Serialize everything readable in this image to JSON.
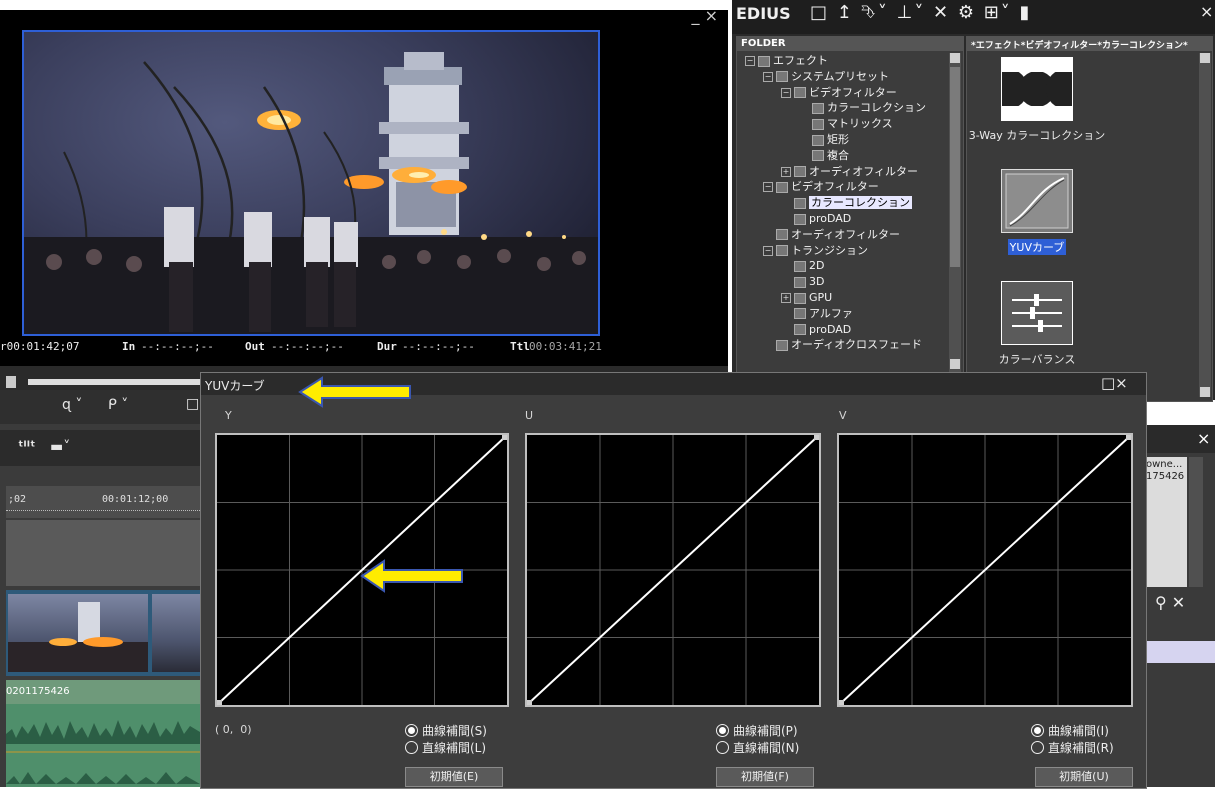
{
  "player": {
    "close_controls": "_ ×",
    "timecodes": {
      "cur": "00:01:42;07",
      "in_label": "In",
      "in_value": "--:--:--;--",
      "out_label": "Out",
      "out_value": "--:--:--;--",
      "dur_label": "Dur",
      "dur_value": "--:--:--;--",
      "ttl_label": "Ttl",
      "ttl_value": "00:03:41;21"
    }
  },
  "timeline": {
    "ruler": {
      "left": ";02",
      "right": "00:01:12;00"
    },
    "clip_name": "0201175426"
  },
  "bin": {
    "app_name": "EDIUS",
    "toolbar_glyphs": "□ ↥ ⮷˅ ⊥˅ ✕ ⚙ ⊞˅ ▮",
    "close": "×",
    "folder_header": "FOLDER",
    "tree": [
      {
        "label": "エフェクト",
        "indent": 0,
        "expander": "−"
      },
      {
        "label": "システムプリセット",
        "indent": 1,
        "expander": "−"
      },
      {
        "label": "ビデオフィルター",
        "indent": 2,
        "expander": "−"
      },
      {
        "label": "カラーコレクション",
        "indent": 3,
        "expander": ""
      },
      {
        "label": "マトリックス",
        "indent": 3,
        "expander": ""
      },
      {
        "label": "矩形",
        "indent": 3,
        "expander": ""
      },
      {
        "label": "複合",
        "indent": 3,
        "expander": ""
      },
      {
        "label": "オーディオフィルター",
        "indent": 2,
        "expander": "+"
      },
      {
        "label": "ビデオフィルター",
        "indent": 1,
        "expander": "−"
      },
      {
        "label": "カラーコレクション",
        "indent": 2,
        "expander": "",
        "selected": true
      },
      {
        "label": "proDAD",
        "indent": 2,
        "expander": ""
      },
      {
        "label": "オーディオフィルター",
        "indent": 1,
        "expander": ""
      },
      {
        "label": "トランジション",
        "indent": 1,
        "expander": "−"
      },
      {
        "label": "2D",
        "indent": 2,
        "expander": ""
      },
      {
        "label": "3D",
        "indent": 2,
        "expander": ""
      },
      {
        "label": "GPU",
        "indent": 2,
        "expander": "+"
      },
      {
        "label": "アルファ",
        "indent": 2,
        "expander": ""
      },
      {
        "label": "proDAD",
        "indent": 2,
        "expander": ""
      },
      {
        "label": "オーディオクロスフェード",
        "indent": 1,
        "expander": ""
      }
    ],
    "effects_header": "*エフェクト*ビデオフィルター*カラーコレクション*",
    "effects": [
      {
        "label": "3-Way カラーコレクション",
        "icon": "three-way-icon"
      },
      {
        "label": "YUVカーブ",
        "icon": "curve-icon",
        "selected": true
      },
      {
        "label": "カラーバランス",
        "icon": "sliders-icon"
      }
    ]
  },
  "side_panel": {
    "close": "×",
    "owner_text": "owne...",
    "id_text": "175426",
    "icons": "⚲ ✕"
  },
  "dialog": {
    "title": "YUVカーブ",
    "title_controls": "□×",
    "coord_readout": "( 0,  0)",
    "graphs": [
      {
        "label": "Y",
        "curve_label": "曲線補間(S)",
        "linear_label": "直線補間(L)",
        "reset_label": "初期値(E)"
      },
      {
        "label": "U",
        "curve_label": "曲線補間(P)",
        "linear_label": "直線補間(N)",
        "reset_label": "初期値(F)"
      },
      {
        "label": "V",
        "curve_label": "曲線補間(I)",
        "linear_label": "直線補間(R)",
        "reset_label": "初期値(U)"
      }
    ]
  },
  "colors": {
    "arrow_fill": "#ffec00",
    "arrow_stroke": "#3a57b0",
    "selection_blue": "#2e5fd6",
    "curve_line": "#ffffff"
  }
}
